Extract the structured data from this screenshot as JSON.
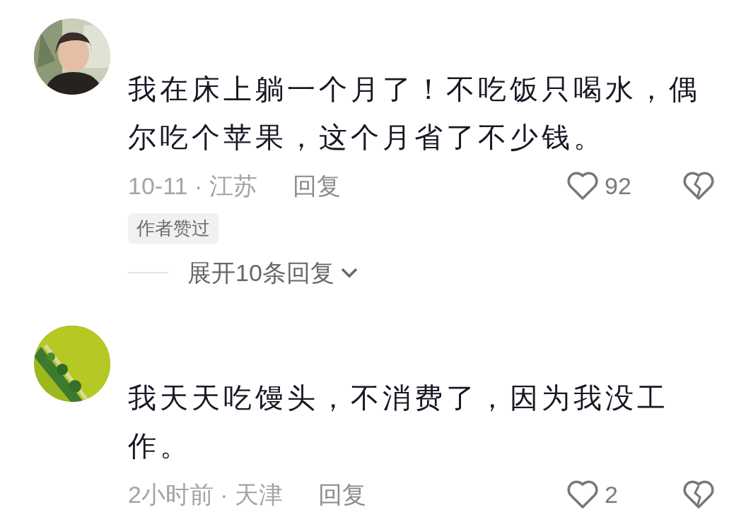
{
  "comments": [
    {
      "text": "我在床上躺一个月了！不吃饭只喝水，偶尔吃个苹果，这个月省了不少钱。",
      "meta": "10-11 · 江苏",
      "reply": "回复",
      "likes": "92",
      "tag": "作者赞过",
      "expand": "展开10条回复"
    },
    {
      "text": "我天天吃馒头，不消费了，因为我没工作。",
      "meta": "2小时前 · 天津",
      "reply": "回复",
      "likes": "2"
    }
  ]
}
